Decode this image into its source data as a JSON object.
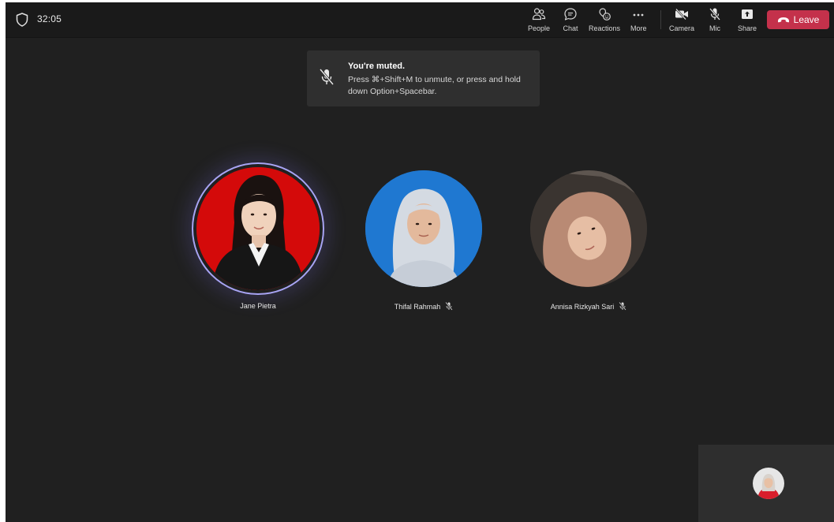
{
  "meeting": {
    "timer": "32:05"
  },
  "toolbar": {
    "people_label": "People",
    "chat_label": "Chat",
    "reactions_label": "Reactions",
    "more_label": "More",
    "camera_label": "Camera",
    "mic_label": "Mic",
    "share_label": "Share",
    "leave_label": "Leave",
    "leave_color": "#c4314b"
  },
  "toast": {
    "title": "You're muted.",
    "message": "Press ⌘+Shift+M to unmute, or press and hold down Option+Spacebar."
  },
  "participants": [
    {
      "name": "Jane Pietra",
      "muted": false,
      "speaking": true,
      "avatar_bg": "#d40a0a"
    },
    {
      "name": "Thifal Rahmah",
      "muted": true,
      "speaking": false,
      "avatar_bg": "#1f78d1"
    },
    {
      "name": "Annisa Rizkyah Sari",
      "muted": true,
      "speaking": false,
      "avatar_bg": "#3a3430"
    }
  ],
  "icons": {
    "security": "shield-icon",
    "people": "people-icon",
    "chat": "chat-icon",
    "reactions": "reactions-icon",
    "more": "more-icon",
    "camera": "camera-off-icon",
    "mic": "mic-off-icon",
    "share": "share-icon",
    "leave": "phone-hangup-icon"
  }
}
